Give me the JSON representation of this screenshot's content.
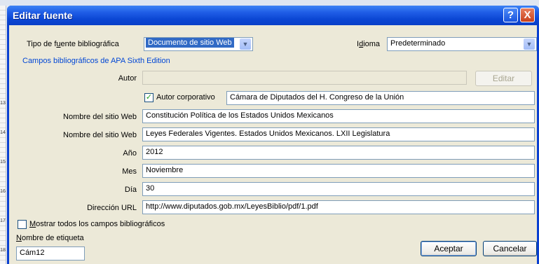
{
  "dialog": {
    "title": "Editar fuente",
    "help_label": "?",
    "close_label": "X"
  },
  "source_type": {
    "label_pre": "Tipo de f",
    "label_key": "u",
    "label_post": "ente bibliográfica",
    "value": "Documento de sitio Web"
  },
  "language": {
    "label_pre": "I",
    "label_key": "d",
    "label_post": "ioma",
    "value": "Predeterminado"
  },
  "section_header": "Campos bibliográficos de APA Sixth Edition",
  "author": {
    "label": "Autor",
    "value": "",
    "edit_button": "Editar"
  },
  "corporate_author": {
    "label": "Autor corporativo",
    "checked": true,
    "check_glyph": "✓",
    "value": "Cámara de Diputados del H. Congreso de la Unión"
  },
  "fields": [
    {
      "label": "Nombre del sitio Web",
      "value": "Constitución Política de los Estados Unidos Mexicanos"
    },
    {
      "label": "Nombre del sitio Web",
      "value": "Leyes Federales Vigentes. Estados Unidos Mexicanos. LXII Legislatura"
    },
    {
      "label": "Año",
      "value": "2012"
    },
    {
      "label": "Mes",
      "value": "Noviembre"
    },
    {
      "label": "Día",
      "value": "30"
    },
    {
      "label": "Dirección URL",
      "value": "http://www.diputados.gob.mx/LeyesBiblio/pdf/1.pdf"
    }
  ],
  "show_all": {
    "label_key": "M",
    "label_post": "ostrar todos los campos bibliográficos",
    "checked": false
  },
  "tag_name": {
    "label_key": "N",
    "label_post": "ombre de etiqueta",
    "value": "Cám12"
  },
  "buttons": {
    "accept": "Aceptar",
    "cancel": "Cancelar"
  },
  "ruler_numbers": [
    "13",
    "14",
    "15",
    "16",
    "17",
    "18"
  ],
  "colors": {
    "titlebar": "#0b46d3",
    "client_bg": "#ece9d8",
    "section_header": "#0046d5",
    "selection": "#316ac5"
  }
}
